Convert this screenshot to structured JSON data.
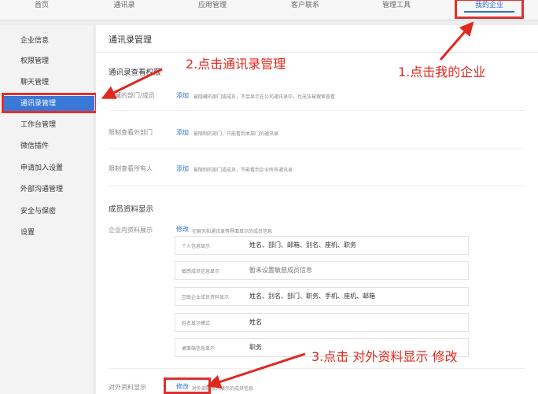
{
  "topnav": {
    "items": [
      "首页",
      "通讯录",
      "应用管理",
      "客户联系",
      "管理工具",
      "我的企业"
    ]
  },
  "sidebar": {
    "items": [
      "企业信息",
      "权限管理",
      "聊天管理",
      "通讯录管理",
      "工作台管理",
      "微信插件",
      "申请加入设置",
      "外部沟通管理",
      "安全与保密",
      "设置"
    ]
  },
  "main": {
    "title": "通讯录管理",
    "view_perm": {
      "title": "通讯录查看权限",
      "rows": [
        {
          "label": "隐藏的部门/成员",
          "action": "添加",
          "desc": "被隐藏的部门或成员，不会显示在公司通讯录中，也无法被搜索查看"
        },
        {
          "label": "限制查看外部门",
          "action": "添加",
          "desc": "被限制的部门，只能看到本部门的通讯录"
        },
        {
          "label": "限制查看所有人",
          "action": "添加",
          "desc": "被限制的部门或成员，不能看到企业所有通讯录"
        }
      ]
    },
    "member_display": {
      "title": "成员资料显示",
      "internal_label": "企业内资料展示",
      "internal_edit": "修改",
      "internal_desc": "在聊天和通讯录等界面显示的成员信息",
      "boxes": [
        {
          "label": "个人信息显示",
          "value": "姓名、部门、邮箱、别名、座机、职务"
        },
        {
          "label": "敏感成员信息显示",
          "value": "暂未设置敏感成员信息"
        },
        {
          "label": "互联企业成员资料显示",
          "value": "姓名、别名、部门、职务、手机、座机、邮箱"
        },
        {
          "label": "姓名显示模式",
          "value": "姓名"
        },
        {
          "label": "桌面端信息显示",
          "value": "职务"
        }
      ],
      "external_label": "对外资料显示",
      "external_edit": "修改",
      "external_desc": "对外部联系人展示的成员信息"
    }
  },
  "annotations": {
    "step1": "1.点击我的企业",
    "step2": "2.点击通讯录管理",
    "step3": "3.点击 对外资料显示 修改"
  },
  "colors": {
    "accent": "#2a6fd6",
    "sidebar_active": "#3a78d8",
    "annotation": "#e0281e"
  }
}
